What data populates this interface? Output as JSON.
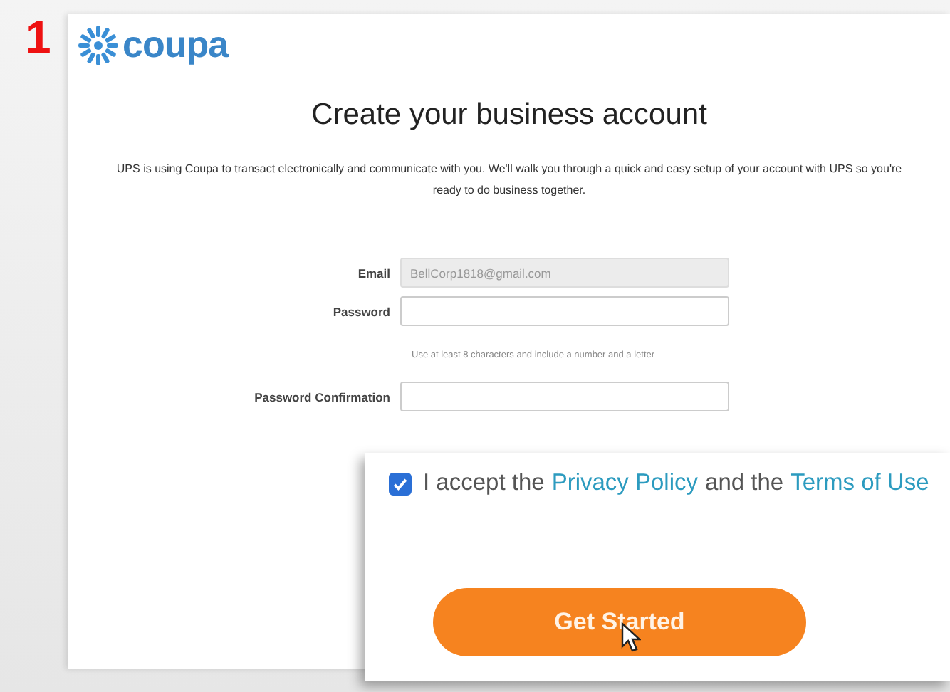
{
  "step_number": "1",
  "logo": {
    "text": "coupa"
  },
  "title": "Create your business account",
  "intro": "UPS is using Coupa to transact electronically and communicate with you. We'll walk you through a quick and easy setup of your account with UPS so you're ready to do business together.",
  "fields": [
    {
      "label": "Email",
      "value": "BellCorp1818@gmail.com",
      "disabled": true
    },
    {
      "label": "Password",
      "disabled": false,
      "hint": "Use at least 8 characters and include a number and a letter"
    },
    {
      "label": "Password Confirmation",
      "disabled": false
    }
  ],
  "callout": {
    "checkbox": {
      "checked": true,
      "parts": [
        {
          "kind": "text",
          "text": "I accept the"
        },
        {
          "kind": "link",
          "text": "Privacy Policy"
        },
        {
          "kind": "text",
          "text": "and the"
        },
        {
          "kind": "link",
          "text": "Terms of Use"
        }
      ]
    },
    "button": "Get Started"
  }
}
